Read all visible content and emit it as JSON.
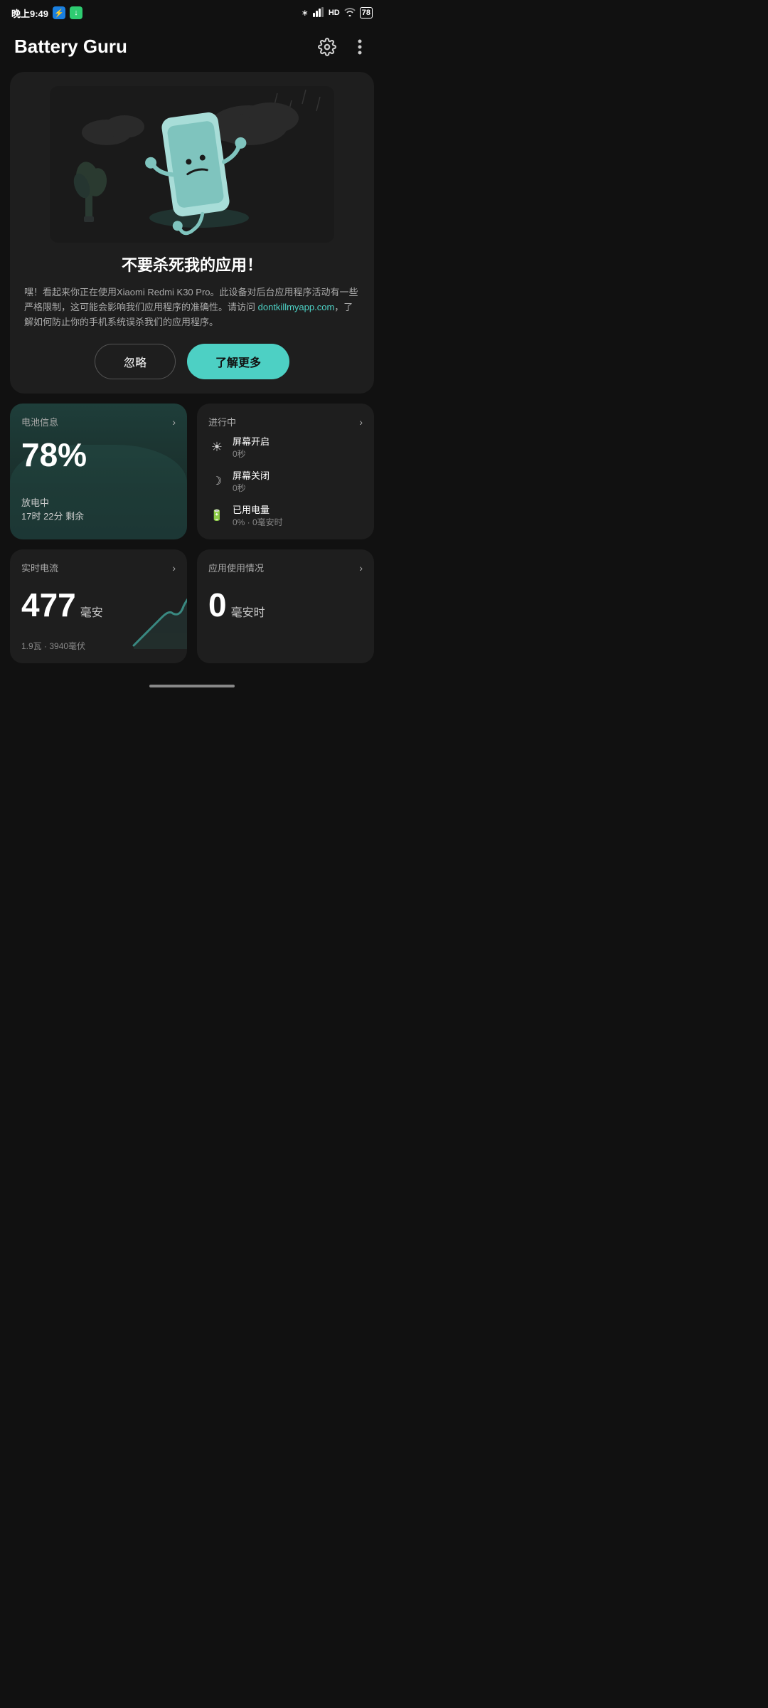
{
  "status_bar": {
    "time": "晚上9:49",
    "battery_level": "78",
    "icons": [
      "bluetooth",
      "hd",
      "signal",
      "wifi",
      "battery"
    ]
  },
  "header": {
    "title": "Battery Guru",
    "settings_label": "设置",
    "more_label": "更多"
  },
  "warning_card": {
    "title": "不要杀死我的应用！",
    "body": "嘿！看起来你正在使用Xiaomi Redmi K30 Pro。此设备对后台应用程序活动有一些严格限制，这可能会影响我们应用程序的准确性。请访问 ",
    "link_text": "dontkillmyapp.com",
    "body_after": "，了解如何防止你的手机系统误杀我们的应用程序。",
    "btn_ignore": "忽略",
    "btn_learn": "了解更多"
  },
  "battery_info": {
    "title": "电池信息",
    "percentage": "78%",
    "status": "放电中",
    "remaining": "17时 22分 剩余"
  },
  "in_progress": {
    "title": "进行中",
    "items": [
      {
        "icon": "☀",
        "label": "屏幕开启",
        "value": "0秒"
      },
      {
        "icon": "☾",
        "label": "屏幕关闭",
        "value": "0秒"
      },
      {
        "icon": "⚡",
        "label": "已用电量",
        "value": "0% · 0毫安时"
      }
    ]
  },
  "realtime_current": {
    "title": "实时电流",
    "value": "477",
    "unit": "毫安",
    "sub": "1.9瓦 · 3940毫伏"
  },
  "app_usage": {
    "title": "应用使用情况",
    "value": "0",
    "unit": "毫安时"
  }
}
